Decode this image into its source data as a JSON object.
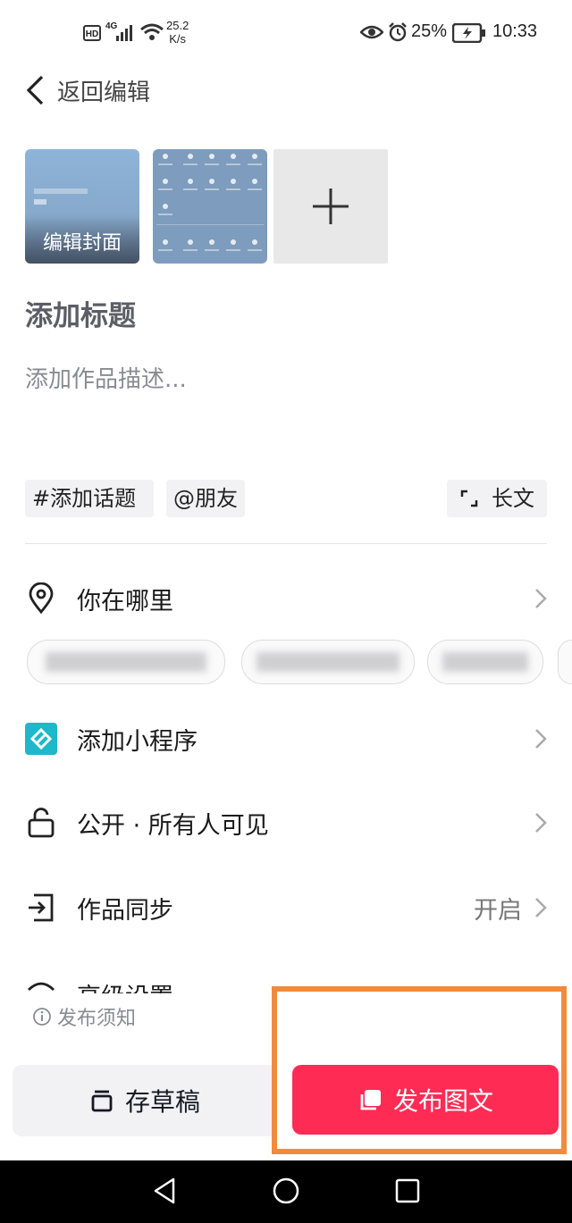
{
  "status_bar": {
    "hd": "HD",
    "network": "4G",
    "speed_value": "25.2",
    "speed_unit": "K/s",
    "battery_percent": "25%",
    "time": "10:33"
  },
  "header": {
    "back_label": "返回编辑"
  },
  "media": {
    "cover_label": "编辑封面"
  },
  "post": {
    "title_placeholder": "添加标题",
    "description_placeholder": "添加作品描述..."
  },
  "chips": {
    "topic": "#添加话题",
    "mention": "@朋友",
    "long_text": "长文"
  },
  "rows": {
    "location": "你在哪里",
    "mini_program": "添加小程序",
    "visibility": "公开 · 所有人可见",
    "sync": "作品同步",
    "sync_value": "开启",
    "advanced": "高级设置"
  },
  "footer": {
    "notice": "发布须知",
    "draft": "存草稿",
    "publish": "发布图文"
  },
  "colors": {
    "accent": "#fe2c55",
    "highlight": "#f08a3c",
    "mini_program": "#1db8c9"
  }
}
